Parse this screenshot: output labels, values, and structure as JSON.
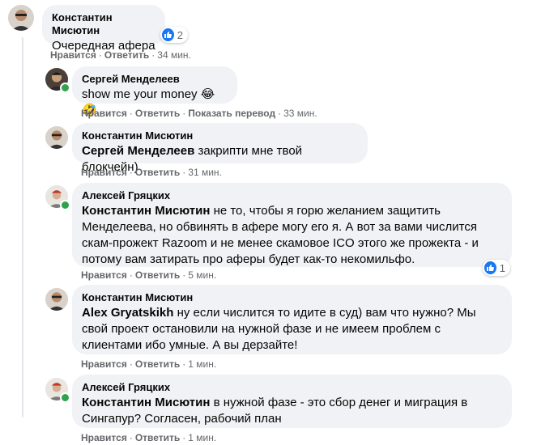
{
  "comments": [
    {
      "author": "Константин Мисютин",
      "text": "Очередная афера",
      "reaction_count": "2",
      "like": "Нравится",
      "reply": "Ответить",
      "time": "34 мин."
    },
    {
      "author": "Сергей Менделеев",
      "text": "show me your money",
      "emojis": "😂🤣",
      "like": "Нравится",
      "reply": "Ответить",
      "translate": "Показать перевод",
      "time": "33 мин."
    },
    {
      "author": "Константин Мисютин",
      "mention": "Сергей Менделеев",
      "text": "закрипти мне твой блокчейн)",
      "like": "Нравится",
      "reply": "Ответить",
      "time": "31 мин."
    },
    {
      "author": "Алексей Гряцких",
      "mention": "Константин Мисютин",
      "text": "не то, чтобы я горю желанием защитить Менделеева, но обвинять в афере могу его я. А вот за вами числится скам-прожект Razoom и не менее скамовое ICO этого же прожекта - и потому вам затирать про аферы будет как-то некомильфо.",
      "reaction_count": "1",
      "like": "Нравится",
      "reply": "Ответить",
      "time": "5 мин."
    },
    {
      "author": "Константин Мисютин",
      "mention": "Alex Gryatskikh",
      "text": "ну если числится то идите в суд) вам что нужно? Мы свой проект остановили на нужной фазе и не имеем проблем с клиентами ибо умные. А вы дерзайте!",
      "like": "Нравится",
      "reply": "Ответить",
      "time": "1 мин."
    },
    {
      "author": "Алексей Гряцких",
      "mention": "Константин Мисютин",
      "text": "в нужной фазе - это сбор денег и миграция в Сингапур? Согласен, рабочий план",
      "like": "Нравится",
      "reply": "Ответить",
      "time": "1 мин."
    }
  ],
  "colors": {
    "bubble": "#f0f2f5",
    "secondary_text": "#65676b",
    "like_blue": "#1877f2",
    "online_green": "#31a24c"
  }
}
